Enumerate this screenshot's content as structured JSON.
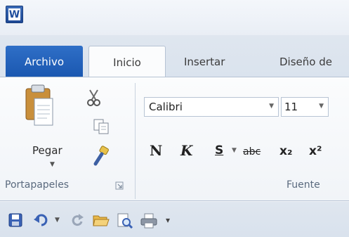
{
  "app": {
    "icon_letter": "W"
  },
  "tabs": {
    "file": "Archivo",
    "home": "Inicio",
    "insert": "Insertar",
    "design": "Diseño de"
  },
  "clipboard": {
    "paste_label": "Pegar",
    "group_label": "Portapapeles"
  },
  "font": {
    "font_name": "Calibri",
    "font_size": "11",
    "group_label": "Fuente",
    "bold_label": "N",
    "italic_label": "K",
    "underline_label": "S",
    "strike_label": "abc",
    "subscript_label": "x₂",
    "superscript_label": "x²"
  },
  "quick_access": {
    "icons": [
      "save-icon",
      "undo-icon",
      "redo-icon",
      "open-icon",
      "print-preview-icon",
      "print-icon",
      "customize-icon"
    ]
  }
}
